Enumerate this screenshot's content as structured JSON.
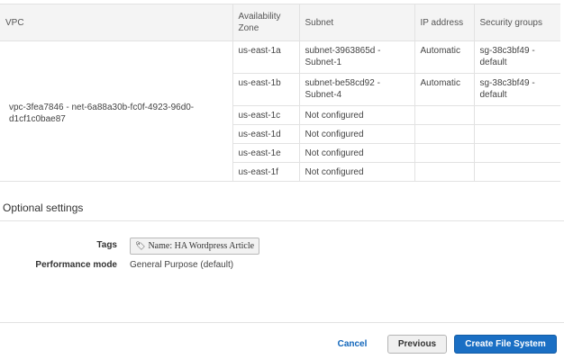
{
  "targets_table": {
    "headers": {
      "vpc": "VPC",
      "availability_zone": "Availability Zone",
      "subnet": "Subnet",
      "ip_address": "IP address",
      "security_groups": "Security groups"
    },
    "vpc": "vpc-3fea7846 - net-6a88a30b-fc0f-4923-96d0-d1cf1c0bae87",
    "rows": [
      {
        "az": "us-east-1a",
        "subnet": "subnet-3963865d - Subnet-1",
        "ip": "Automatic",
        "sg": "sg-38c3bf49 - default"
      },
      {
        "az": "us-east-1b",
        "subnet": "subnet-be58cd92 - Subnet-4",
        "ip": "Automatic",
        "sg": "sg-38c3bf49 - default"
      },
      {
        "az": "us-east-1c",
        "subnet": "Not configured",
        "ip": "",
        "sg": ""
      },
      {
        "az": "us-east-1d",
        "subnet": "Not configured",
        "ip": "",
        "sg": ""
      },
      {
        "az": "us-east-1e",
        "subnet": "Not configured",
        "ip": "",
        "sg": ""
      },
      {
        "az": "us-east-1f",
        "subnet": "Not configured",
        "ip": "",
        "sg": ""
      }
    ]
  },
  "optional_settings": {
    "title": "Optional settings",
    "tags_label": "Tags",
    "tag_value": "Name: HA Wordpress Article",
    "performance_mode_label": "Performance mode",
    "performance_mode_value": "General Purpose (default)"
  },
  "footer": {
    "cancel_label": "Cancel",
    "previous_label": "Previous",
    "create_label": "Create File System"
  },
  "colors": {
    "primary_button": "#1a6fc4",
    "link": "#1166bb",
    "header_bg": "#f4f4f4"
  },
  "icons": {
    "tag": "tag-icon"
  }
}
